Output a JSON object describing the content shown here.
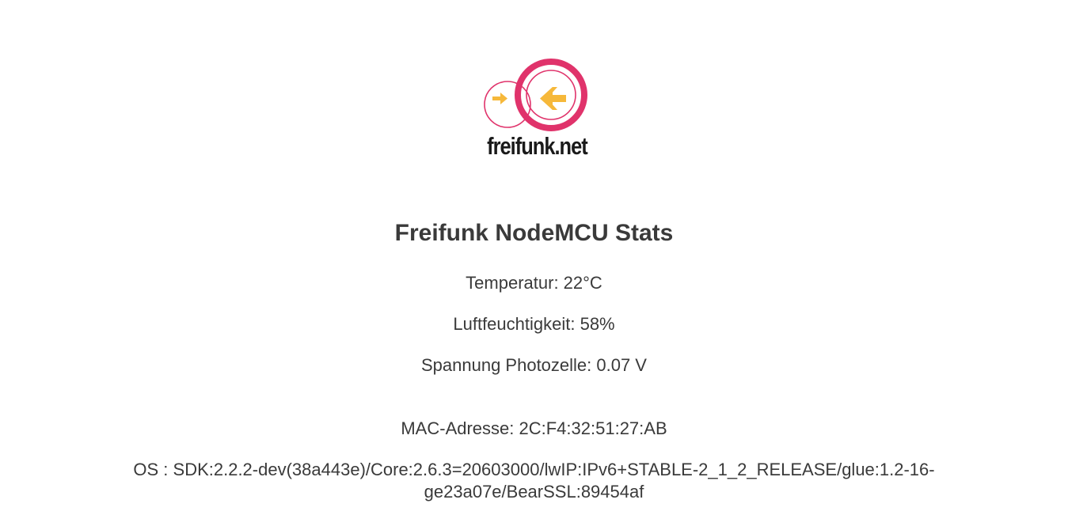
{
  "logo": {
    "text": "freifunk.net",
    "colors": {
      "ring": "#e0336b",
      "arrow": "#f6b83a",
      "text": "#1a1a1a"
    }
  },
  "page": {
    "title": "Freifunk NodeMCU Stats",
    "temperature": "Temperatur: 22°C",
    "humidity": "Luftfeuchtigkeit: 58%",
    "voltage": "Spannung Photozelle: 0.07 V",
    "mac": "MAC-Adresse: 2C:F4:32:51:27:AB",
    "os": "OS : SDK:2.2.2-dev(38a443e)/Core:2.6.3=20603000/lwIP:IPv6+STABLE-2_1_2_RELEASE/glue:1.2-16-ge23a07e/BearSSL:89454af"
  },
  "colors": {
    "text": "#3a3a3a",
    "background": "#ffffff"
  }
}
